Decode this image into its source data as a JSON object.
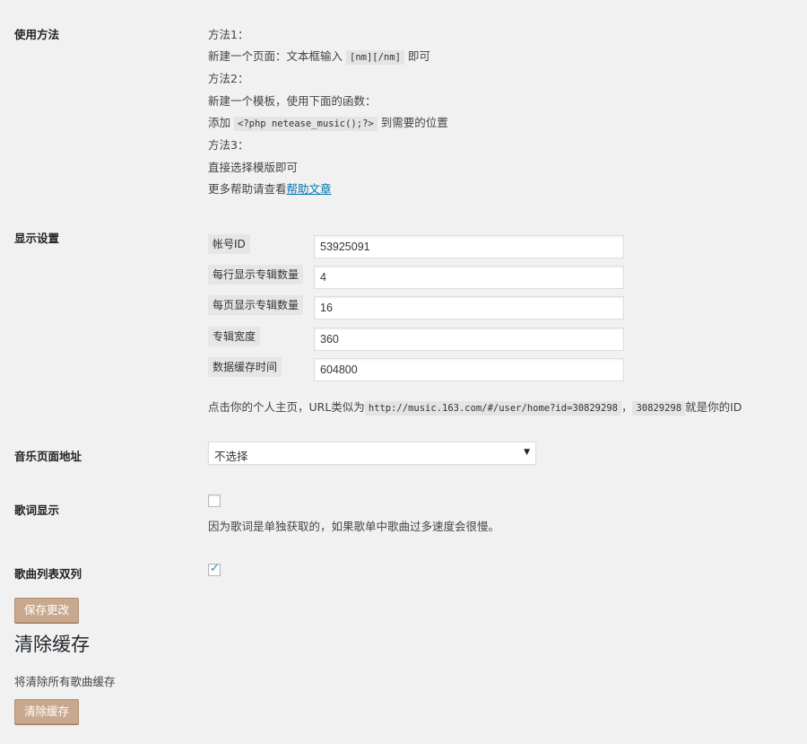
{
  "usage": {
    "label": "使用方法",
    "m1_title": "方法1：",
    "m1_text_a": "新建一个页面：文本框输入",
    "m1_code": "[nm][/nm]",
    "m1_text_b": "即可",
    "m2_title": "方法2：",
    "m2_text": "新建一个模板，使用下面的函数：",
    "m2_add": "添加",
    "m2_code": "<?php netease_music();?>",
    "m2_text_b": "到需要的位置",
    "m3_title": "方法3：",
    "m3_text": "直接选择模版即可",
    "more_text": "更多帮助请查看",
    "help_link": "帮助文章"
  },
  "display": {
    "label": "显示设置",
    "fields": [
      {
        "label": "帐号ID",
        "value": "53925091"
      },
      {
        "label": "每行显示专辑数量",
        "value": "4"
      },
      {
        "label": "每页显示专辑数量",
        "value": "16"
      },
      {
        "label": "专辑宽度",
        "value": "360"
      },
      {
        "label": "数据缓存时间",
        "value": "604800"
      }
    ],
    "hint_a": "点击你的个人主页，URL类似为",
    "hint_code1": "http://music.163.com/#/user/home?id=30829298",
    "hint_comma": "，",
    "hint_code2": "30829298",
    "hint_b": "就是你的ID"
  },
  "music_page": {
    "label": "音乐页面地址",
    "selected": "不选择"
  },
  "lyrics": {
    "label": "歌词显示",
    "checked": false,
    "note": "因为歌词是单独获取的，如果歌单中歌曲过多速度会很慢。"
  },
  "two_column": {
    "label": "歌曲列表双列",
    "checked": true
  },
  "save_button": "保存更改",
  "cache": {
    "title": "清除缓存",
    "desc": "将清除所有歌曲缓存",
    "button": "清除缓存"
  },
  "colors": {
    "background": "#f1f1f1",
    "button": "#c9a98e",
    "link": "#0073aa"
  }
}
